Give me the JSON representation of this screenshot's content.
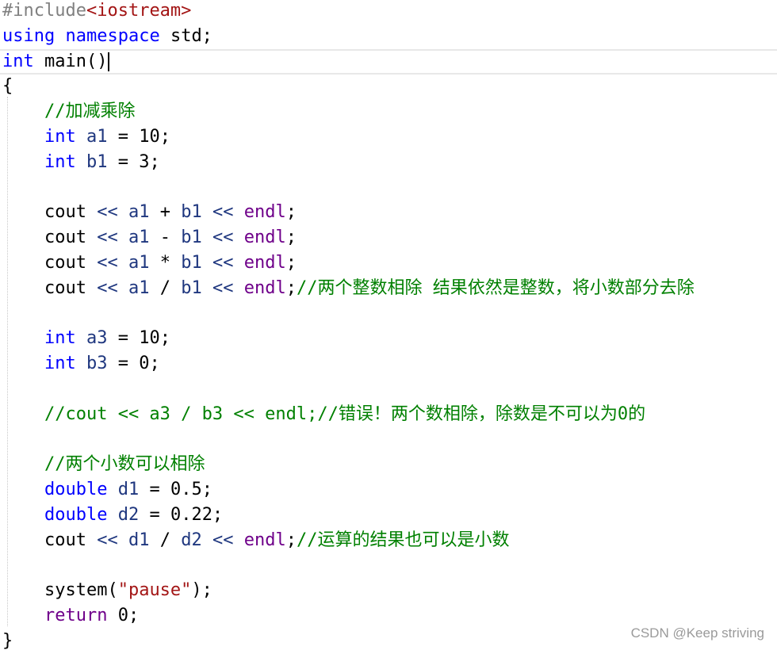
{
  "editor": {
    "colors": {
      "keyword": "#0000ff",
      "type": "#2b91af",
      "preprocessor": "#808080",
      "include_path": "#a31515",
      "comment": "#008000",
      "string": "#a31515",
      "identifier": "#000000",
      "variable": "#1f377f",
      "stream_object": "#1f1f1f",
      "macro_like": "#6f008a",
      "current_line_border": "#e8e8e8",
      "watermark": "#9a9a9a"
    },
    "lines": [
      [
        {
          "t": "#include",
          "c": "preprocessor"
        },
        {
          "t": "<iostream>",
          "c": "include_path"
        }
      ],
      [
        {
          "t": "using",
          "c": "keyword"
        },
        {
          "t": " ",
          "c": "identifier"
        },
        {
          "t": "namespace",
          "c": "keyword"
        },
        {
          "t": " std;",
          "c": "identifier"
        }
      ],
      [
        {
          "t": "int",
          "c": "keyword"
        },
        {
          "t": " main()",
          "c": "identifier"
        }
      ],
      [
        {
          "t": "{",
          "c": "identifier"
        }
      ],
      [
        {
          "t": "    //加减乘除",
          "c": "comment"
        }
      ],
      [
        {
          "t": "    ",
          "c": "identifier"
        },
        {
          "t": "int",
          "c": "keyword"
        },
        {
          "t": " ",
          "c": "identifier"
        },
        {
          "t": "a1",
          "c": "variable"
        },
        {
          "t": " = 10;",
          "c": "identifier"
        }
      ],
      [
        {
          "t": "    ",
          "c": "identifier"
        },
        {
          "t": "int",
          "c": "keyword"
        },
        {
          "t": " ",
          "c": "identifier"
        },
        {
          "t": "b1",
          "c": "variable"
        },
        {
          "t": " = 3;",
          "c": "identifier"
        }
      ],
      [],
      [
        {
          "t": "    cout ",
          "c": "identifier"
        },
        {
          "t": "<<",
          "c": "variable"
        },
        {
          "t": " ",
          "c": "identifier"
        },
        {
          "t": "a1",
          "c": "variable"
        },
        {
          "t": " + ",
          "c": "identifier"
        },
        {
          "t": "b1",
          "c": "variable"
        },
        {
          "t": " ",
          "c": "identifier"
        },
        {
          "t": "<<",
          "c": "variable"
        },
        {
          "t": " ",
          "c": "identifier"
        },
        {
          "t": "endl",
          "c": "macro_like"
        },
        {
          "t": ";",
          "c": "identifier"
        }
      ],
      [
        {
          "t": "    cout ",
          "c": "identifier"
        },
        {
          "t": "<<",
          "c": "variable"
        },
        {
          "t": " ",
          "c": "identifier"
        },
        {
          "t": "a1",
          "c": "variable"
        },
        {
          "t": " - ",
          "c": "identifier"
        },
        {
          "t": "b1",
          "c": "variable"
        },
        {
          "t": " ",
          "c": "identifier"
        },
        {
          "t": "<<",
          "c": "variable"
        },
        {
          "t": " ",
          "c": "identifier"
        },
        {
          "t": "endl",
          "c": "macro_like"
        },
        {
          "t": ";",
          "c": "identifier"
        }
      ],
      [
        {
          "t": "    cout ",
          "c": "identifier"
        },
        {
          "t": "<<",
          "c": "variable"
        },
        {
          "t": " ",
          "c": "identifier"
        },
        {
          "t": "a1",
          "c": "variable"
        },
        {
          "t": " * ",
          "c": "identifier"
        },
        {
          "t": "b1",
          "c": "variable"
        },
        {
          "t": " ",
          "c": "identifier"
        },
        {
          "t": "<<",
          "c": "variable"
        },
        {
          "t": " ",
          "c": "identifier"
        },
        {
          "t": "endl",
          "c": "macro_like"
        },
        {
          "t": ";",
          "c": "identifier"
        }
      ],
      [
        {
          "t": "    cout ",
          "c": "identifier"
        },
        {
          "t": "<<",
          "c": "variable"
        },
        {
          "t": " ",
          "c": "identifier"
        },
        {
          "t": "a1",
          "c": "variable"
        },
        {
          "t": " / ",
          "c": "identifier"
        },
        {
          "t": "b1",
          "c": "variable"
        },
        {
          "t": " ",
          "c": "identifier"
        },
        {
          "t": "<<",
          "c": "variable"
        },
        {
          "t": " ",
          "c": "identifier"
        },
        {
          "t": "endl",
          "c": "macro_like"
        },
        {
          "t": ";",
          "c": "identifier"
        },
        {
          "t": "//两个整数相除 结果依然是整数，将小数部分去除",
          "c": "comment"
        }
      ],
      [],
      [
        {
          "t": "    ",
          "c": "identifier"
        },
        {
          "t": "int",
          "c": "keyword"
        },
        {
          "t": " ",
          "c": "identifier"
        },
        {
          "t": "a3",
          "c": "variable"
        },
        {
          "t": " = 10;",
          "c": "identifier"
        }
      ],
      [
        {
          "t": "    ",
          "c": "identifier"
        },
        {
          "t": "int",
          "c": "keyword"
        },
        {
          "t": " ",
          "c": "identifier"
        },
        {
          "t": "b3",
          "c": "variable"
        },
        {
          "t": " = 0;",
          "c": "identifier"
        }
      ],
      [],
      [
        {
          "t": "    //cout << a3 / b3 << endl;//错误！两个数相除，除数是不可以为0的",
          "c": "comment"
        }
      ],
      [],
      [
        {
          "t": "    //两个小数可以相除",
          "c": "comment"
        }
      ],
      [
        {
          "t": "    ",
          "c": "identifier"
        },
        {
          "t": "double",
          "c": "keyword"
        },
        {
          "t": " ",
          "c": "identifier"
        },
        {
          "t": "d1",
          "c": "variable"
        },
        {
          "t": " = 0.5;",
          "c": "identifier"
        }
      ],
      [
        {
          "t": "    ",
          "c": "identifier"
        },
        {
          "t": "double",
          "c": "keyword"
        },
        {
          "t": " ",
          "c": "identifier"
        },
        {
          "t": "d2",
          "c": "variable"
        },
        {
          "t": " = 0.22;",
          "c": "identifier"
        }
      ],
      [
        {
          "t": "    cout ",
          "c": "identifier"
        },
        {
          "t": "<<",
          "c": "variable"
        },
        {
          "t": " ",
          "c": "identifier"
        },
        {
          "t": "d1",
          "c": "variable"
        },
        {
          "t": " / ",
          "c": "identifier"
        },
        {
          "t": "d2",
          "c": "variable"
        },
        {
          "t": " ",
          "c": "identifier"
        },
        {
          "t": "<<",
          "c": "variable"
        },
        {
          "t": " ",
          "c": "identifier"
        },
        {
          "t": "endl",
          "c": "macro_like"
        },
        {
          "t": ";",
          "c": "identifier"
        },
        {
          "t": "//运算的结果也可以是小数",
          "c": "comment"
        }
      ],
      [],
      [
        {
          "t": "    system(",
          "c": "identifier"
        },
        {
          "t": "\"pause\"",
          "c": "string"
        },
        {
          "t": ");",
          "c": "identifier"
        }
      ],
      [
        {
          "t": "    ",
          "c": "identifier"
        },
        {
          "t": "return",
          "c": "macro_like"
        },
        {
          "t": " 0;",
          "c": "identifier"
        }
      ],
      [
        {
          "t": "}",
          "c": "identifier"
        }
      ]
    ],
    "current_line_index": 2
  },
  "watermark": {
    "text": "CSDN @Keep striving"
  }
}
